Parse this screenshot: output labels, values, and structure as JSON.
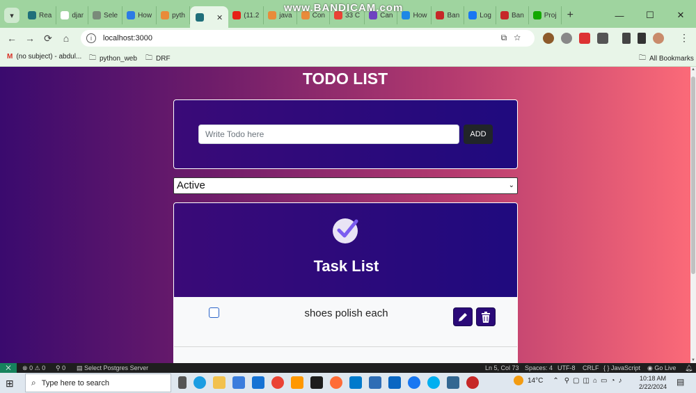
{
  "browser": {
    "watermark": "www.BANDICAM.com",
    "tabs": [
      {
        "label": "Rea",
        "color": "#1f6f7a"
      },
      {
        "label": "djar",
        "color": "#ffffff"
      },
      {
        "label": "Sele",
        "color": "#7a8a7a"
      },
      {
        "label": "How",
        "color": "#2c7be5"
      },
      {
        "label": "pyth",
        "color": "#e88b3a"
      },
      {
        "label": "",
        "color": "#1f6f7a",
        "active": true,
        "close": "✕"
      },
      {
        "label": "(11.2",
        "color": "#e62117"
      },
      {
        "label": "java",
        "color": "#e88b3a"
      },
      {
        "label": "Con",
        "color": "#e88b3a"
      },
      {
        "label": "33 C",
        "color": "#ea4335"
      },
      {
        "label": "Can",
        "color": "#6f42c1"
      },
      {
        "label": "How",
        "color": "#1e88e5"
      },
      {
        "label": "Ban",
        "color": "#c62828"
      },
      {
        "label": "Log",
        "color": "#1877f2"
      },
      {
        "label": "Ban",
        "color": "#c62828"
      },
      {
        "label": "Proj",
        "color": "#14a800"
      }
    ],
    "new_tab": "+",
    "url": "localhost:3000",
    "bookmarks": [
      {
        "label": "(no subject) - abdul...",
        "icon": "gmail-icon"
      },
      {
        "label": "python_web",
        "icon": "folder-icon"
      },
      {
        "label": "DRF",
        "icon": "folder-icon"
      },
      {
        "label": "All Bookmarks",
        "icon": "folder-icon"
      }
    ]
  },
  "page": {
    "title": "TODO LIST",
    "input_placeholder": "Write Todo here",
    "add_label": "ADD",
    "filter_value": "Active",
    "task_list_title": "Task List",
    "tasks": [
      {
        "text": "shoes polish each",
        "done": false
      }
    ]
  },
  "statusbar": {
    "errors": "0",
    "warnings": "0",
    "ports": "0",
    "db_label": "Select Postgres Server",
    "position": "Ln 5, Col 73",
    "spaces": "Spaces: 4",
    "encoding": "UTF-8",
    "eol": "CRLF",
    "language": "JavaScript",
    "golive": "Go Live"
  },
  "taskbar": {
    "search_placeholder": "Type here to search",
    "weather": "14°C",
    "time": "10:18 AM",
    "date": "2/22/2024"
  },
  "colors": {
    "accent": "#3a0a78",
    "button_dark": "#212529",
    "action_button": "#2b0a78"
  }
}
